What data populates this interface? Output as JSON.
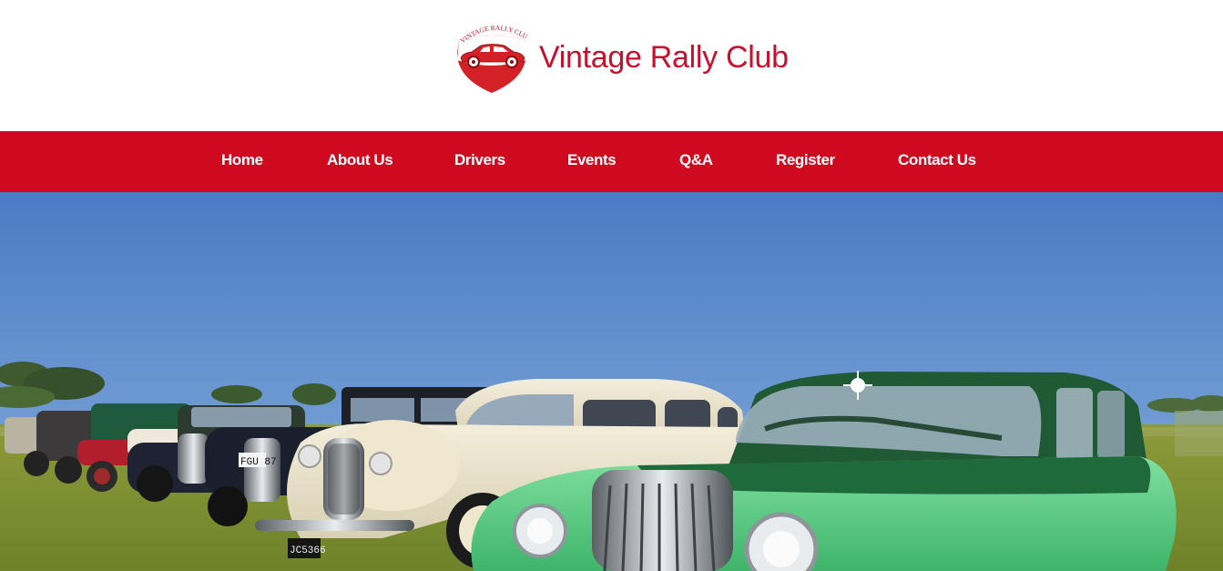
{
  "header": {
    "logo_text": "VINTAGE RALLY CLUB",
    "site_title": "Vintage Rally Club",
    "brand_color": "#c8102e"
  },
  "nav": {
    "background": "#cf0a1f",
    "items": [
      {
        "label": "Home"
      },
      {
        "label": "About Us"
      },
      {
        "label": "Drivers"
      },
      {
        "label": "Events"
      },
      {
        "label": "Q&A"
      },
      {
        "label": "Register"
      },
      {
        "label": "Contact Us"
      }
    ]
  },
  "hero": {
    "license_plate": "JC5366",
    "license_plate_2": "FGU 87"
  }
}
